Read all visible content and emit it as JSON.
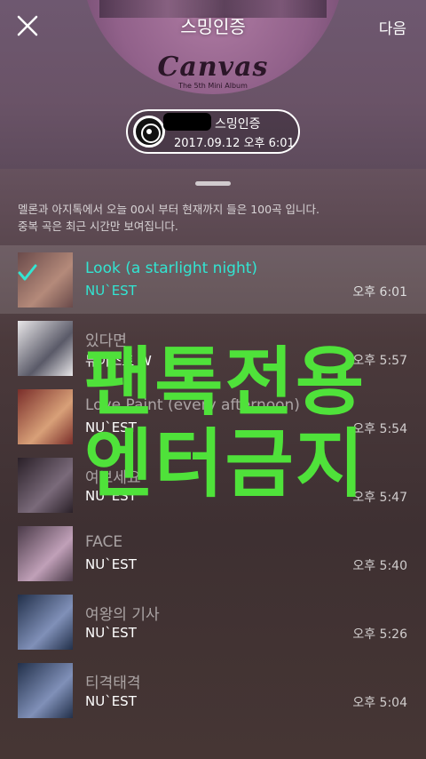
{
  "header": {
    "overlay_title": "스밍인증",
    "next_label": "다음",
    "album_title": "Canvas",
    "album_subtitle": "The 5th Mini Album"
  },
  "certificate": {
    "label": "스밍인증",
    "datetime": "2017.09.12 오후 6:01"
  },
  "notice": {
    "line1": "멜론과 아지톡에서 오늘 00시 부터 현재까지 들은 100곡 입니다.",
    "line2": "중복 곡은 최근 시간만 보여집니다."
  },
  "colors": {
    "accent": "#32e5d2",
    "watermark": "#4fe23a"
  },
  "songs": [
    {
      "title": "Look (a starlight night)",
      "artist": "NU`EST",
      "time": "오후 6:01",
      "active": true,
      "art": [
        "#6a4a4a",
        "#b48a7a"
      ]
    },
    {
      "title": "있다면",
      "artist": "뉴이스트 W",
      "time": "오후 5:57",
      "active": false,
      "art": [
        "#e8e6e8",
        "#5a5a68"
      ]
    },
    {
      "title": "Love Paint (every afternoon)",
      "artist": "NU`EST",
      "time": "오후 5:54",
      "active": false,
      "art": [
        "#7a2e2a",
        "#d8a078"
      ]
    },
    {
      "title": "여보세요",
      "artist": "NU`EST",
      "time": "오후 5:47",
      "active": false,
      "art": [
        "#2a2028",
        "#7a6a7a"
      ]
    },
    {
      "title": "FACE",
      "artist": "NU`EST",
      "time": "오후 5:40",
      "active": false,
      "art": [
        "#4a3a48",
        "#c0a0b8"
      ]
    },
    {
      "title": "여왕의 기사",
      "artist": "NU`EST",
      "time": "오후 5:26",
      "active": false,
      "art": [
        "#22304a",
        "#8090b8"
      ]
    },
    {
      "title": "티격태격",
      "artist": "NU`EST",
      "time": "오후 5:04",
      "active": false,
      "art": [
        "#22304a",
        "#8090b8"
      ]
    }
  ],
  "watermark": {
    "line1": "팬톡전용",
    "line2": "엔터금지"
  }
}
